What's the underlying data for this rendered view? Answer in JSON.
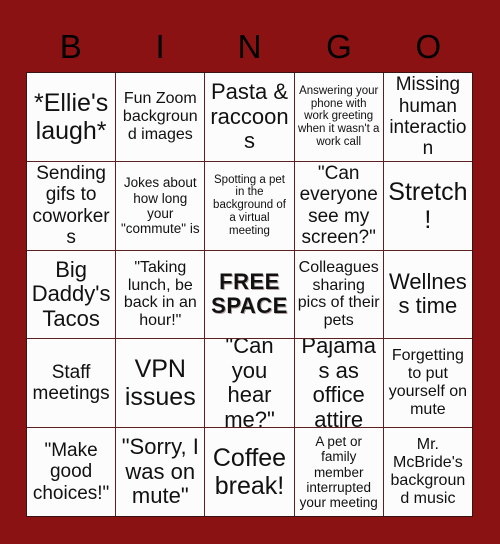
{
  "card": {
    "background_color": "#8B1212",
    "cell_background_color": "#FCFCFC",
    "border_color": "#5C2020",
    "text_color": "#111111",
    "header": {
      "letters": [
        "B",
        "I",
        "N",
        "G",
        "O"
      ]
    },
    "grid": {
      "columns": 5,
      "rows": 5,
      "cells": [
        {
          "text": "*Ellie's laugh*",
          "size": "xxl",
          "free": false
        },
        {
          "text": "Fun Zoom background images",
          "size": "md",
          "free": false
        },
        {
          "text": "Pasta & raccoons",
          "size": "xl",
          "free": false
        },
        {
          "text": "Answering your phone with work greeting when it wasn't a work call",
          "size": "xs",
          "free": false
        },
        {
          "text": "Missing human interaction",
          "size": "lg",
          "free": false
        },
        {
          "text": "Sending gifs to coworkers",
          "size": "lg",
          "free": false
        },
        {
          "text": "Jokes about how long your \"commute\" is",
          "size": "sm",
          "free": false
        },
        {
          "text": "Spotting a pet in the background of a virtual meeting",
          "size": "xs",
          "free": false
        },
        {
          "text": "\"Can everyone see my screen?\"",
          "size": "lg",
          "free": false
        },
        {
          "text": "Stretch!",
          "size": "xxl",
          "free": false
        },
        {
          "text": "Big Daddy's Tacos",
          "size": "xl",
          "free": false
        },
        {
          "text": "\"Taking lunch, be back in an hour!\"",
          "size": "md",
          "free": false
        },
        {
          "text": "FREE SPACE",
          "size": "xl",
          "free": true
        },
        {
          "text": "Colleagues sharing pics of their pets",
          "size": "md",
          "free": false
        },
        {
          "text": "Wellness time",
          "size": "xl",
          "free": false
        },
        {
          "text": "Staff meetings",
          "size": "lg",
          "free": false
        },
        {
          "text": "VPN issues",
          "size": "xxl",
          "free": false
        },
        {
          "text": "\"Can you hear me?\"",
          "size": "xl",
          "free": false
        },
        {
          "text": "Pajamas as office attire",
          "size": "xl",
          "free": false
        },
        {
          "text": "Forgetting to put yourself on mute",
          "size": "md",
          "free": false
        },
        {
          "text": "\"Make good choices!\"",
          "size": "lg",
          "free": false
        },
        {
          "text": "\"Sorry, I was on mute\"",
          "size": "xl",
          "free": false
        },
        {
          "text": "Coffee break!",
          "size": "xxl",
          "free": false
        },
        {
          "text": "A pet or family member interrupted your meeting",
          "size": "sm",
          "free": false
        },
        {
          "text": "Mr. McBride's background music",
          "size": "md",
          "free": false
        }
      ]
    }
  }
}
